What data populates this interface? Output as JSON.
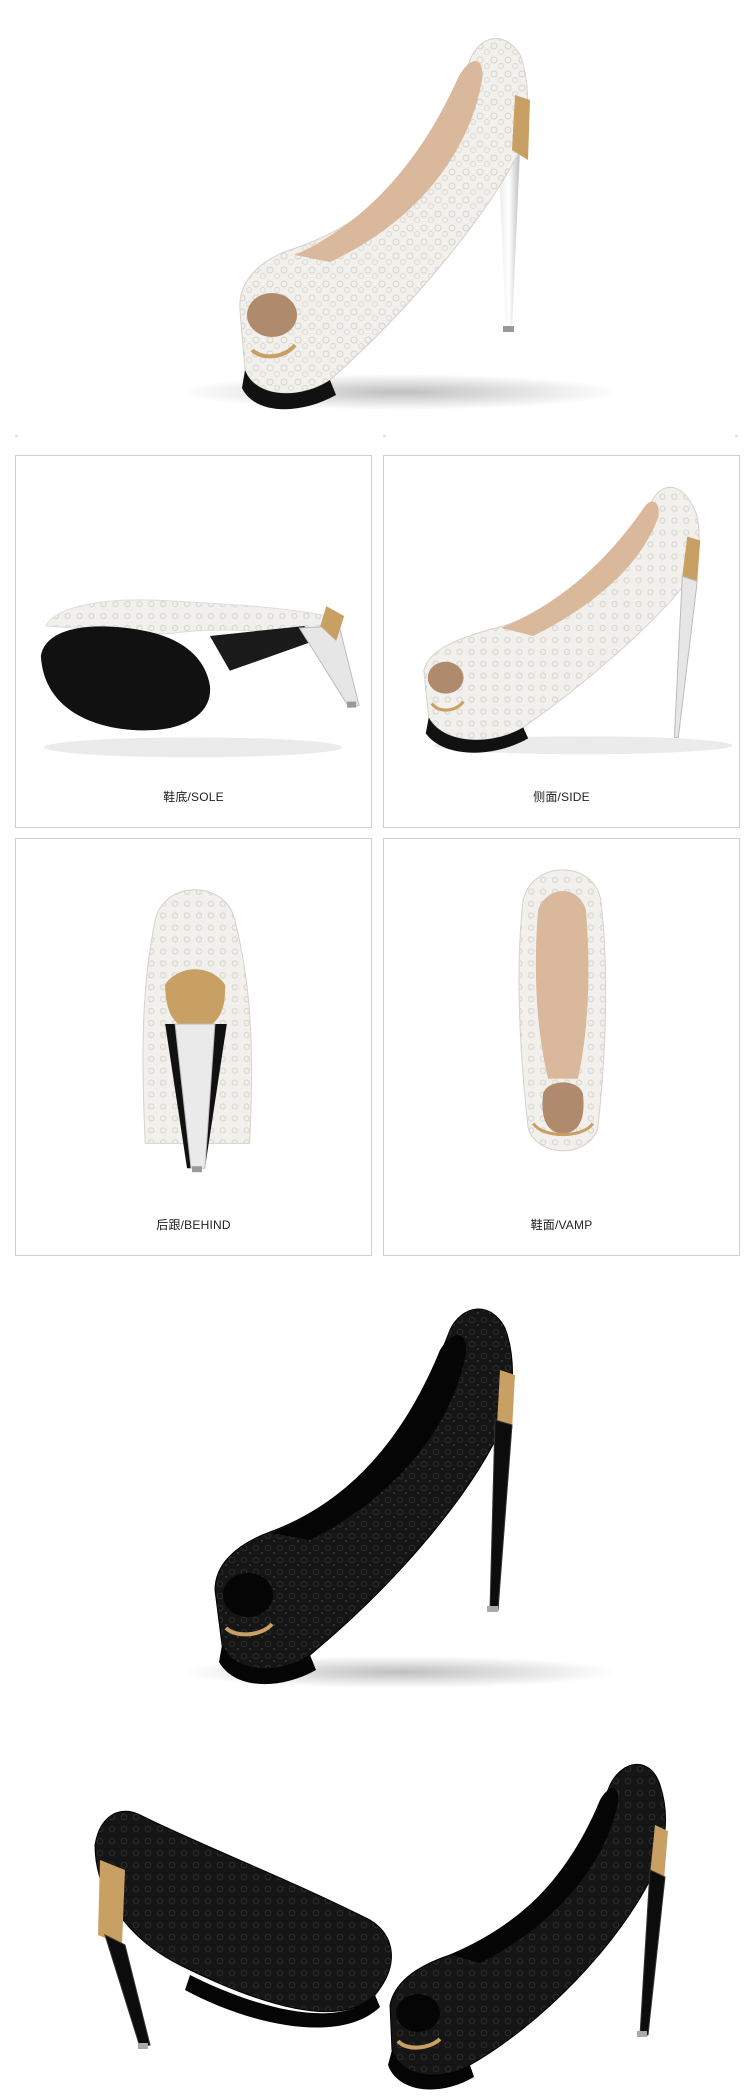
{
  "cards": [
    {
      "label": "鞋底/SOLE",
      "view": "sole-view",
      "shoe_color": "white"
    },
    {
      "label": "侧面/SIDE",
      "view": "side-view",
      "shoe_color": "white"
    },
    {
      "label": "后跟/BEHIND",
      "view": "behind-view",
      "shoe_color": "white"
    },
    {
      "label": "鞋面/VAMP",
      "view": "vamp-view",
      "shoe_color": "white"
    }
  ],
  "colors": {
    "background": "#ffffff",
    "card_border": "#cfcfcf",
    "lace_white": "#f3f1ee",
    "lace_black": "#141414",
    "gold_accent": "#c8a063",
    "sole_black": "#111111"
  }
}
